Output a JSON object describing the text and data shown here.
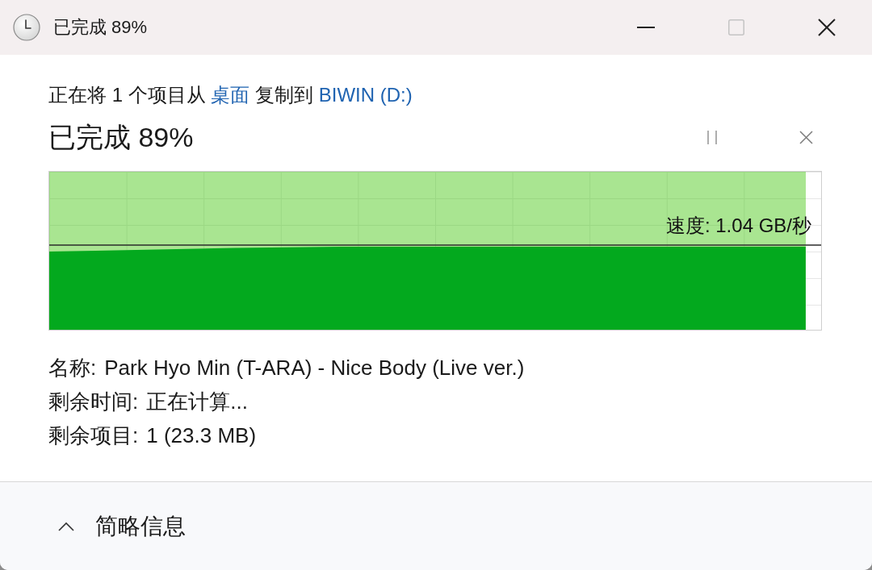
{
  "window": {
    "title": "已完成 89%",
    "controls": [
      {
        "kind": "minimize",
        "disabled": false
      },
      {
        "kind": "maximize",
        "disabled": true
      },
      {
        "kind": "close",
        "disabled": false
      }
    ]
  },
  "operation": {
    "parts": [
      {
        "kind": "text",
        "text": "正在将 1 个项目从"
      },
      {
        "kind": "link",
        "text": "桌面"
      },
      {
        "kind": "text",
        "text": "复制到"
      },
      {
        "kind": "link",
        "text": "BIWIN (D:)"
      }
    ]
  },
  "progress": {
    "heading": "已完成 89%",
    "level": 0.98,
    "speed": "速度: 1.04 GB/秒"
  },
  "details": [
    {
      "label": "名称:",
      "value": "Park Hyo Min (T-ARA) - Nice Body (Live ver.)"
    },
    {
      "label": "剩余时间:",
      "value": "正在计算..."
    },
    {
      "label": "剩余项目:",
      "value": "1 (23.3 MB)"
    }
  ],
  "footer": {
    "toggle": {
      "label": "简略信息",
      "expanded": true
    }
  }
}
